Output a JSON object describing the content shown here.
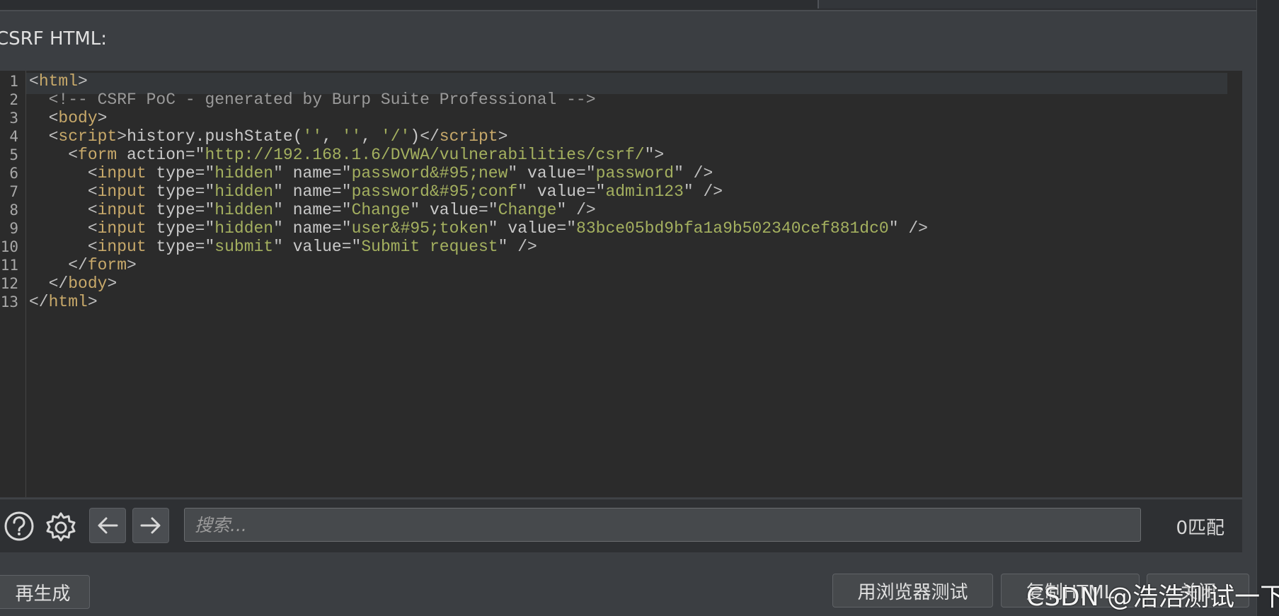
{
  "title": "CSRF HTML:",
  "editor": {
    "line_numbers": [
      "1",
      "2",
      "3",
      "4",
      "5",
      "6",
      "7",
      "8",
      "9",
      "10",
      "11",
      "12",
      "13"
    ]
  },
  "search": {
    "placeholder": "搜索...",
    "match_count": "0匹配"
  },
  "buttons": {
    "regenerate": "再生成",
    "test_in_browser": "用浏览器测试",
    "copy_html": "复制HTML",
    "close": "关闭"
  },
  "watermark": "CSDN @浩浩测试一下",
  "icons": {
    "help": "help-icon",
    "settings": "gear-icon",
    "prev": "arrow-left-icon",
    "next": "arrow-right-icon"
  }
}
